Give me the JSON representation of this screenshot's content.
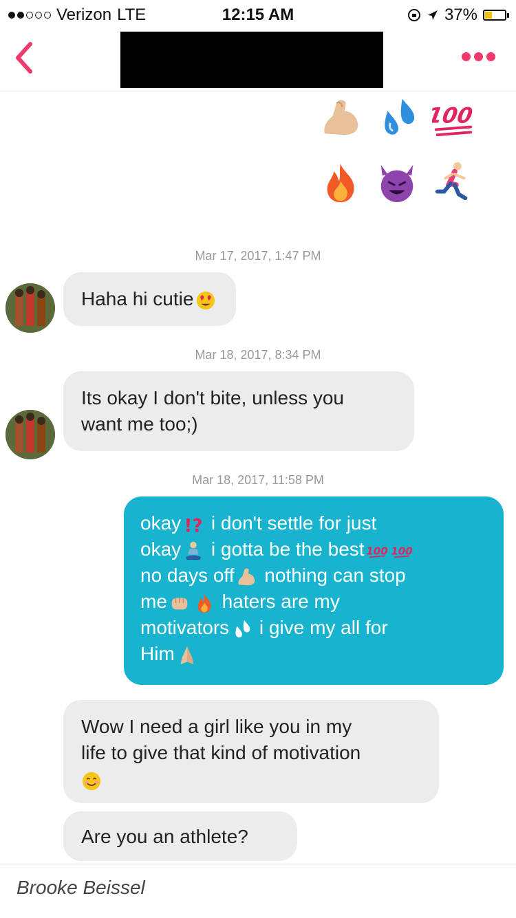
{
  "status_bar": {
    "carrier": "Verizon",
    "network": "LTE",
    "time": "12:15 AM",
    "battery": "37%",
    "battery_level": 0.37
  },
  "header": {
    "back_icon": "chevron-left-icon",
    "more_icon": "more-dots-icon",
    "accent_color": "#f0386b"
  },
  "messages": {
    "emoji_message": [
      "flexed-biceps",
      "sweat-droplets",
      "hundred-points",
      "fire",
      "smiling-devil",
      "person-running"
    ],
    "ts1": "Mar 17, 2017, 1:47 PM",
    "m1": "Haha hi cutie",
    "ts2": "Mar 18, 2017, 8:34 PM",
    "m2_line1": "Its okay I don't bite, unless you",
    "m2_line2": "want me too;)",
    "ts3": "Mar 18, 2017, 11:58 PM",
    "m3": {
      "p1": "okay",
      "p2": " i don't settle for just",
      "p3": "okay",
      "p4": " i gotta be the best",
      "p5": "no days off",
      "p6": " nothing can stop",
      "p7": "me",
      "p8": " haters are my",
      "p9": "motivators",
      "p10": " i give my all for",
      "p11": "Him"
    },
    "m4_line1": "Wow I need a girl like you in my",
    "m4_line2": "life to give that kind of motivation",
    "m5": "Are you an athlete?"
  },
  "footer": {
    "credit": "Brooke Beissel"
  },
  "colors": {
    "outgoing_bubble": "#18b4cf",
    "incoming_bubble": "#ececec"
  }
}
